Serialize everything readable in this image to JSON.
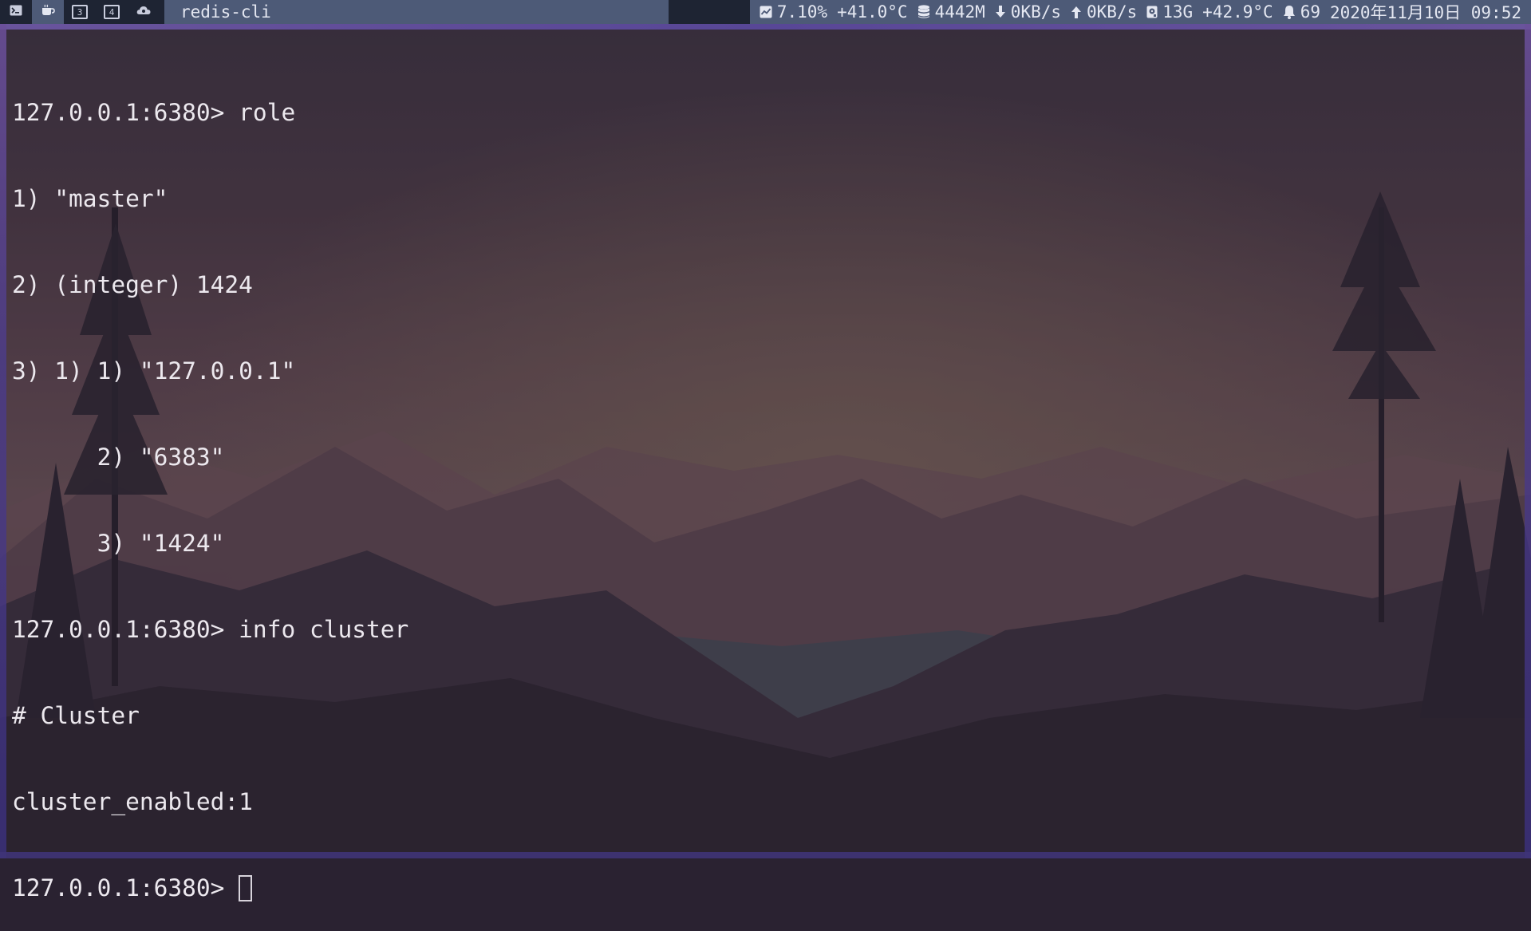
{
  "topbar": {
    "workspaces": [
      {
        "icon": "terminal-icon",
        "active": false
      },
      {
        "icon": "coffee-cup-icon",
        "active": true
      },
      {
        "label": "3",
        "icon": "workspace-3-icon",
        "active": false
      },
      {
        "label": "4",
        "icon": "workspace-4-icon",
        "active": false
      },
      {
        "icon": "cloud-icon",
        "active": false
      }
    ],
    "window_title": "redis-cli",
    "status": {
      "cpu": "7.10%",
      "cpu_temp": "+41.0°C",
      "memory": "4442M",
      "download": "0KB/s",
      "upload": "0KB/s",
      "disk": "13G",
      "disk_temp": "+42.9°C",
      "notifications": "69",
      "datetime": "2020年11月10日 09:52"
    }
  },
  "terminal": {
    "lines": [
      "127.0.0.1:6380> role",
      "1) \"master\"",
      "2) (integer) 1424",
      "3) 1) 1) \"127.0.0.1\"",
      "      2) \"6383\"",
      "      3) \"1424\"",
      "127.0.0.1:6380> info cluster",
      "# Cluster",
      "cluster_enabled:1"
    ],
    "prompt": "127.0.0.1:6380> "
  },
  "colors": {
    "bar_bg": "#1e2433",
    "bar_active": "#4d5a77",
    "terminal_text": "#ece8ee",
    "border_accent": "#5b49a0"
  }
}
